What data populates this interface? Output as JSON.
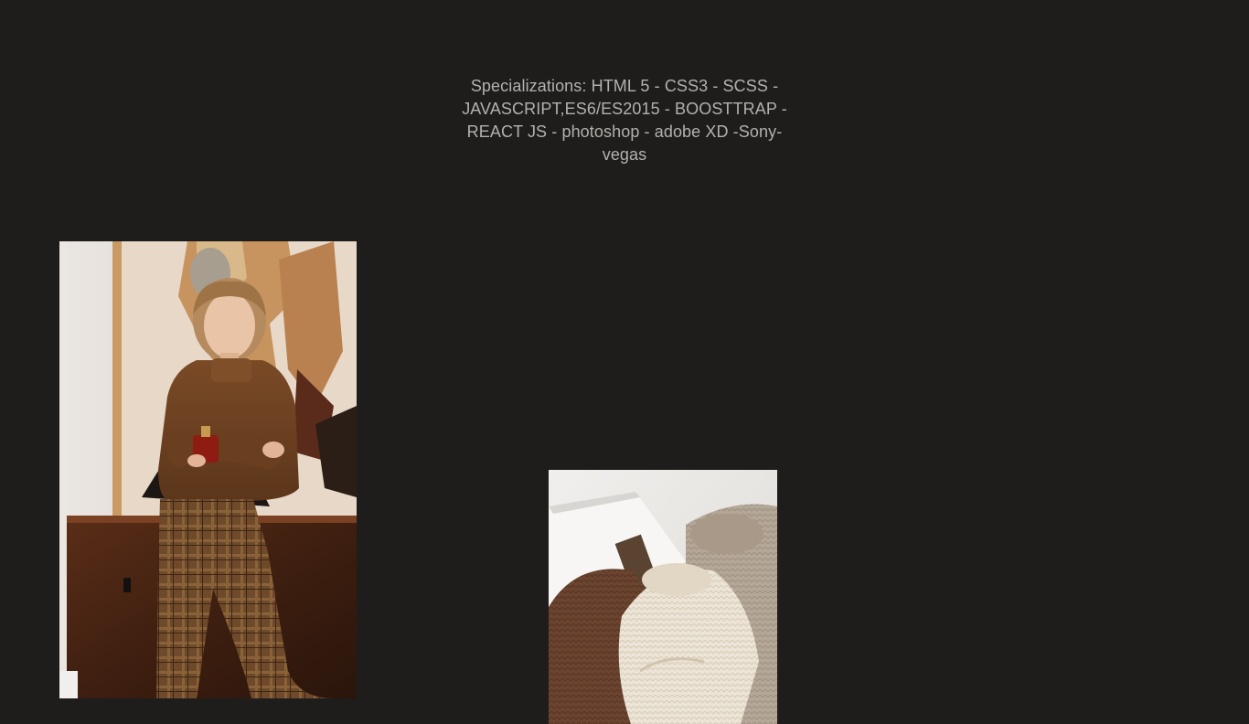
{
  "profile": {
    "specializations_text": "Specializations: HTML 5 - CSS3 - SCSS - JAVASCRIPT,ES6/ES2015 - BOOSTTRAP - REACT JS - photoshop - adobe XD -Sony-vegas"
  },
  "colors": {
    "background": "#1e1d1c",
    "text": "#b3b1ac"
  },
  "gallery": {
    "images": [
      {
        "name": "model-in-brown-sweater-photo"
      },
      {
        "name": "knit-sweaters-photo"
      }
    ]
  }
}
